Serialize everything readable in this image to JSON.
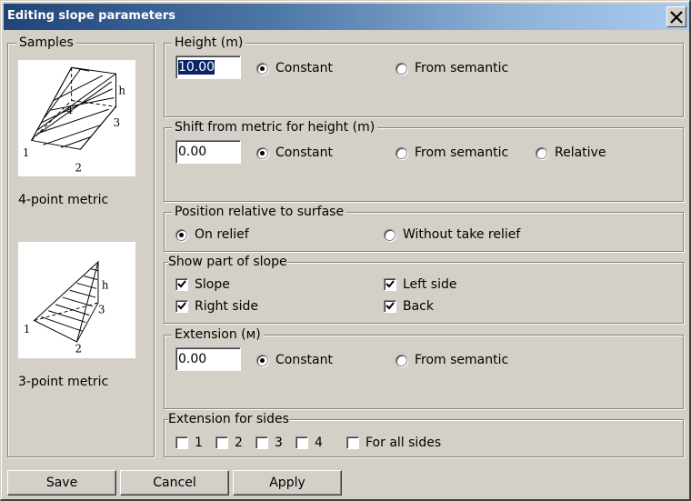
{
  "window": {
    "title": "Editing slope parameters",
    "close_icon": "close-x-icon"
  },
  "samples": {
    "legend": "Samples",
    "items": [
      {
        "label": "4-point metric",
        "image": "four-point-slope-diagram",
        "points": [
          "1",
          "2",
          "3",
          "4"
        ],
        "height_label": "h"
      },
      {
        "label": "3-point metric",
        "image": "three-point-slope-diagram",
        "points": [
          "1",
          "2",
          "3"
        ],
        "height_label": "h"
      }
    ]
  },
  "height": {
    "legend": "Height (m)",
    "value": "10.00",
    "options": [
      {
        "label": "Constant",
        "selected": true
      },
      {
        "label": "From semantic",
        "selected": false
      }
    ]
  },
  "shift": {
    "legend": "Shift from metric for height (m)",
    "value": "0.00",
    "options": [
      {
        "label": "Constant",
        "selected": true
      },
      {
        "label": "From semantic",
        "selected": false
      },
      {
        "label": "Relative",
        "selected": false
      }
    ]
  },
  "position": {
    "legend": "Position relative to surfase",
    "options": [
      {
        "label": "On relief",
        "selected": true
      },
      {
        "label": "Without take relief",
        "selected": false
      }
    ]
  },
  "show_part": {
    "legend": "Show part of slope",
    "items": [
      {
        "label": "Slope",
        "checked": true
      },
      {
        "label": "Left side",
        "checked": true
      },
      {
        "label": "Right side",
        "checked": true
      },
      {
        "label": "Back",
        "checked": true
      }
    ]
  },
  "extension": {
    "legend": "Extension (м)",
    "value": "0.00",
    "options": [
      {
        "label": "Constant",
        "selected": true
      },
      {
        "label": "From semantic",
        "selected": false
      }
    ]
  },
  "extension_sides": {
    "legend": "Extension for sides",
    "items": [
      {
        "label": "1",
        "checked": false
      },
      {
        "label": "2",
        "checked": false
      },
      {
        "label": "3",
        "checked": false
      },
      {
        "label": "4",
        "checked": false
      },
      {
        "label": "For all sides",
        "checked": false
      }
    ]
  },
  "buttons": {
    "save": "Save",
    "cancel": "Cancel",
    "apply": "Apply"
  }
}
